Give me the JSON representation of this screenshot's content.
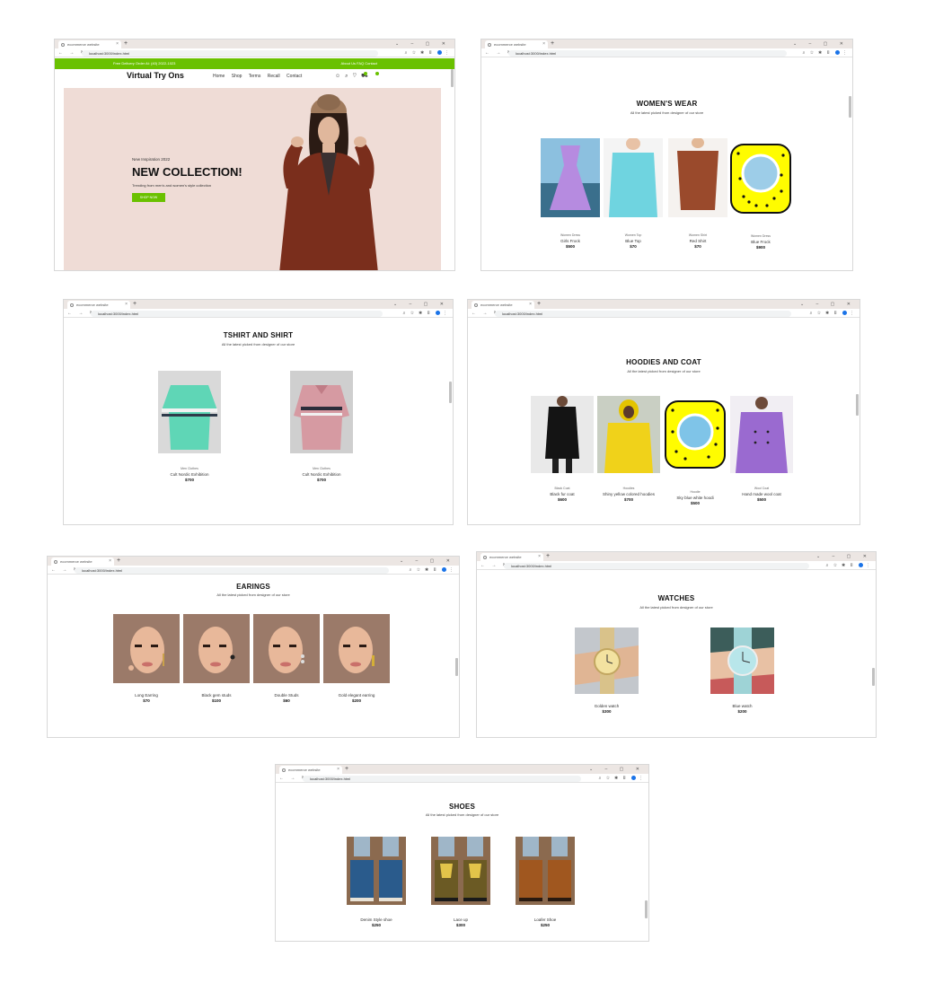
{
  "colors": {
    "accent": "#6ac100",
    "hero_bg": "#efdcd6",
    "snap_yellow": "#fffc00"
  },
  "browser": {
    "tab_title": "ecommerce website",
    "url": "localhost:3000/index.html"
  },
  "home": {
    "top_bar_left": "Free Delivery Order At: (40) 2022-1023",
    "top_bar_right": "About Us   FAQ   Contact",
    "brand": "Virtual Try Ons",
    "menu": [
      "Home",
      "Shop",
      "Terms",
      "Recall",
      "Contact"
    ],
    "icons": [
      "user-icon",
      "search-icon",
      "heart-icon",
      "cart-icon"
    ],
    "hero_small": "New Inspiration 2022",
    "hero_title": "NEW COLLECTION!",
    "hero_desc": "Trending from men's and women's style collection",
    "hero_button": "SHOP NOW"
  },
  "womens": {
    "title": "WOMEN'S WEAR",
    "subtitle": "All the latest picked from designer of our store",
    "products": [
      {
        "cat": "Women Dress",
        "name": "Girls Frock",
        "price": "$500"
      },
      {
        "cat": "Women Top",
        "name": "Blue Top",
        "price": "$70"
      },
      {
        "cat": "Women Shirt",
        "name": "Red Shirt",
        "price": "$70"
      },
      {
        "cat": "Women Dress",
        "name": "Blue Frock",
        "price": "$900"
      }
    ]
  },
  "tshirt": {
    "title": "TSHIRT AND SHIRT",
    "subtitle": "All the latest picked from designer of our store",
    "products": [
      {
        "cat": "Men Clothes",
        "name": "Cult Nordic Exhibition",
        "price": "$700"
      },
      {
        "cat": "Men Clothes",
        "name": "Cult Nordic Exhibition",
        "price": "$700"
      }
    ]
  },
  "hoodies": {
    "title": "HOODIES AND COAT",
    "subtitle": "All the latest picked from designer of our store",
    "products": [
      {
        "cat": "Black Coat",
        "name": "Black fur coat",
        "price": "$600"
      },
      {
        "cat": "Hoodies",
        "name": "Shiny yellow colored hoodies",
        "price": "$700"
      },
      {
        "cat": "Hoodie",
        "name": "Sky blue white hoodi",
        "price": "$500"
      },
      {
        "cat": "Wool Coat",
        "name": "Hand made wool coat",
        "price": "$500"
      }
    ]
  },
  "earings": {
    "title": "EARINGS",
    "subtitle": "All the latest picked from designer of our store",
    "products": [
      {
        "name": "Long Earring",
        "price": "$70"
      },
      {
        "name": "Black gem studs",
        "price": "$100"
      },
      {
        "name": "Double Studs",
        "price": "$60"
      },
      {
        "name": "Gold elegant earring",
        "price": "$200"
      }
    ]
  },
  "watches": {
    "title": "WATCHES",
    "subtitle": "All the latest picked from designer of our store",
    "products": [
      {
        "name": "Golden watch",
        "price": "$300"
      },
      {
        "name": "Blue watch",
        "price": "$200"
      }
    ]
  },
  "shoes": {
    "title": "SHOES",
    "subtitle": "All the latest picked from designer of our store",
    "products": [
      {
        "name": "Denim Style shoe",
        "price": "$250"
      },
      {
        "name": "Lace up",
        "price": "$300"
      },
      {
        "name": "Loafer Shoe",
        "price": "$250"
      }
    ]
  }
}
